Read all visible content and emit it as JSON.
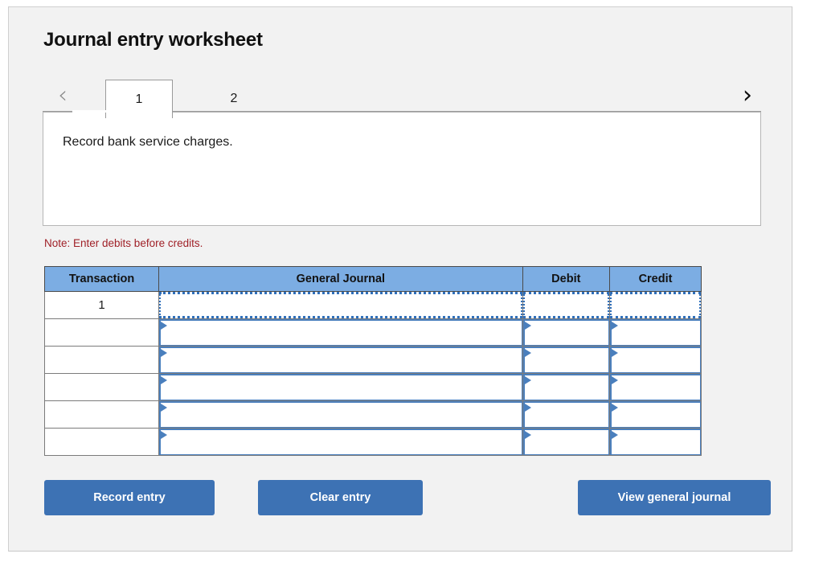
{
  "page": {
    "title": "Journal entry worksheet"
  },
  "tabs": {
    "prev_icon": "‹",
    "next_icon": "›",
    "items": [
      {
        "label": "1",
        "active": true
      },
      {
        "label": "2",
        "active": false
      }
    ]
  },
  "prompt": {
    "text": "Record bank service charges."
  },
  "note": {
    "text": "Note: Enter debits before credits."
  },
  "table": {
    "headers": [
      "Transaction",
      "General Journal",
      "Debit",
      "Credit"
    ],
    "rows": [
      {
        "transaction": "1",
        "general_journal": "",
        "debit": "",
        "credit": "",
        "selected": true
      },
      {
        "transaction": "",
        "general_journal": "",
        "debit": "",
        "credit": "",
        "selected": false
      },
      {
        "transaction": "",
        "general_journal": "",
        "debit": "",
        "credit": "",
        "selected": false
      },
      {
        "transaction": "",
        "general_journal": "",
        "debit": "",
        "credit": "",
        "selected": false
      },
      {
        "transaction": "",
        "general_journal": "",
        "debit": "",
        "credit": "",
        "selected": false
      },
      {
        "transaction": "",
        "general_journal": "",
        "debit": "",
        "credit": "",
        "selected": false
      }
    ]
  },
  "buttons": {
    "record": "Record entry",
    "clear": "Clear entry",
    "view": "View general journal"
  },
  "colors": {
    "panel_bg": "#f2f2f2",
    "header_blue": "#7cadE3",
    "button_blue": "#3d72b4",
    "note_red": "#a02128",
    "field_border_blue": "#4a7fbd"
  }
}
